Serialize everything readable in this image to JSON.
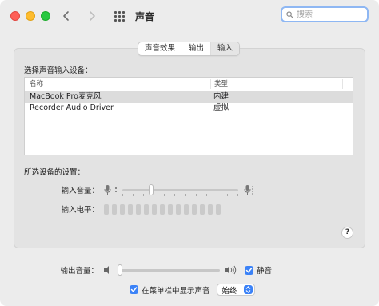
{
  "window": {
    "title": "声音"
  },
  "search": {
    "placeholder": "搜索"
  },
  "tabs": [
    {
      "label": "声音效果",
      "active": false
    },
    {
      "label": "输出",
      "active": false
    },
    {
      "label": "输入",
      "active": true
    }
  ],
  "input": {
    "choose_label": "选择声音输入设备：",
    "columns": {
      "name": "名称",
      "type": "类型"
    },
    "devices": [
      {
        "name": "MacBook Pro麦克风",
        "type": "内建",
        "selected": true
      },
      {
        "name": "Recorder Audio Driver",
        "type": "虚拟",
        "selected": false
      }
    ],
    "selected_settings_label": "所选设备的设置：",
    "volume_label": "输入音量：",
    "volume_value": 0.24,
    "level_label": "输入电平：",
    "level_value": 0
  },
  "output": {
    "volume_label": "输出音量：",
    "volume_value": 0,
    "mute_label": "静音",
    "mute_checked": true
  },
  "menubar": {
    "show_label": "在菜单栏中显示声音",
    "show_checked": true,
    "mode_value": "始终"
  },
  "colors": {
    "accent": "#3b82f7",
    "search_focus": "#8eb7f3"
  }
}
